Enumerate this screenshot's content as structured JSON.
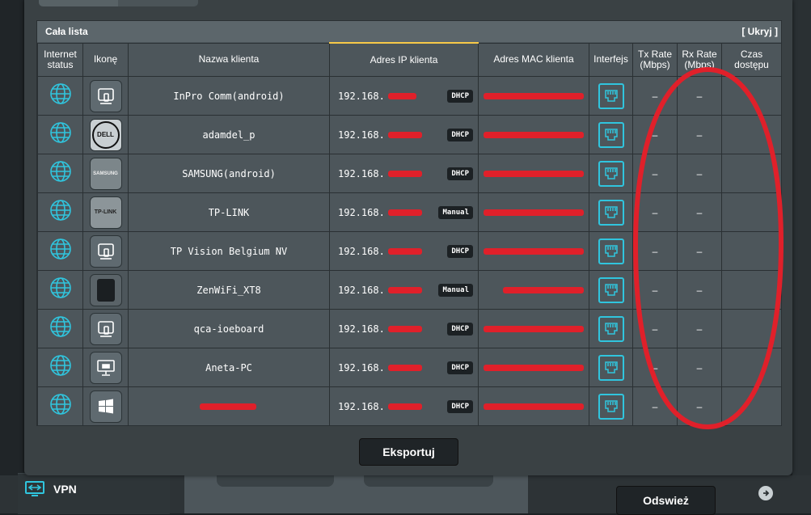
{
  "panel": {
    "title": "Cała lista",
    "hide_label": "[ Ukryj ]"
  },
  "columns": {
    "internet_status": "Internet status",
    "icon": "Ikonę",
    "client_name": "Nazwa klienta",
    "ip": "Adres IP klienta",
    "mac": "Adres MAC klienta",
    "interface": "Interfejs",
    "tx_rate": "Tx Rate (Mbps)",
    "rx_rate": "Rx Rate (Mbps)",
    "access_time": "Czas dostępu"
  },
  "rows": [
    {
      "icon": "generic-device-icon",
      "name": "InPro Comm(android)",
      "ip": "192.168.",
      "mode": "DHCP",
      "tx": "–",
      "rx": "–",
      "time": ""
    },
    {
      "icon": "dell-logo-icon",
      "name": "adamdel_p",
      "ip": "192.168.",
      "mode": "DHCP",
      "tx": "–",
      "rx": "–",
      "time": ""
    },
    {
      "icon": "samsung-logo-icon",
      "name": "SAMSUNG(android)",
      "ip": "192.168.",
      "mode": "DHCP",
      "tx": "–",
      "rx": "–",
      "time": ""
    },
    {
      "icon": "tplink-logo-icon",
      "name": "TP-LINK",
      "ip": "192.168.",
      "mode": "Manual",
      "tx": "–",
      "rx": "–",
      "time": ""
    },
    {
      "icon": "generic-device-icon",
      "name": "TP Vision Belgium NV",
      "ip": "192.168.",
      "mode": "DHCP",
      "tx": "–",
      "rx": "–",
      "time": ""
    },
    {
      "icon": "router-tower-icon",
      "name": "ZenWiFi_XT8",
      "ip": "192.168.",
      "mode": "Manual",
      "tx": "–",
      "rx": "–",
      "time": ""
    },
    {
      "icon": "generic-device-icon",
      "name": "qca-ioeboard",
      "ip": "192.168.",
      "mode": "DHCP",
      "tx": "–",
      "rx": "–",
      "time": ""
    },
    {
      "icon": "desktop-pc-icon",
      "name": "Aneta-PC",
      "ip": "192.168.",
      "mode": "DHCP",
      "tx": "–",
      "rx": "–",
      "time": ""
    },
    {
      "icon": "windows-logo-icon",
      "name": "",
      "ip": "192.168.",
      "mode": "DHCP",
      "tx": "–",
      "rx": "–",
      "time": ""
    }
  ],
  "logos": {
    "dell": "DELL",
    "samsung": "SAMSUNG",
    "tplink": "TP-LINK"
  },
  "buttons": {
    "export": "Eksportuj",
    "refresh": "Odswież"
  },
  "sidebar": {
    "vpn_label": "VPN"
  },
  "colors": {
    "accent_cyan": "#30c5de",
    "redaction": "#e0202a",
    "annotation": "#e0202a"
  }
}
